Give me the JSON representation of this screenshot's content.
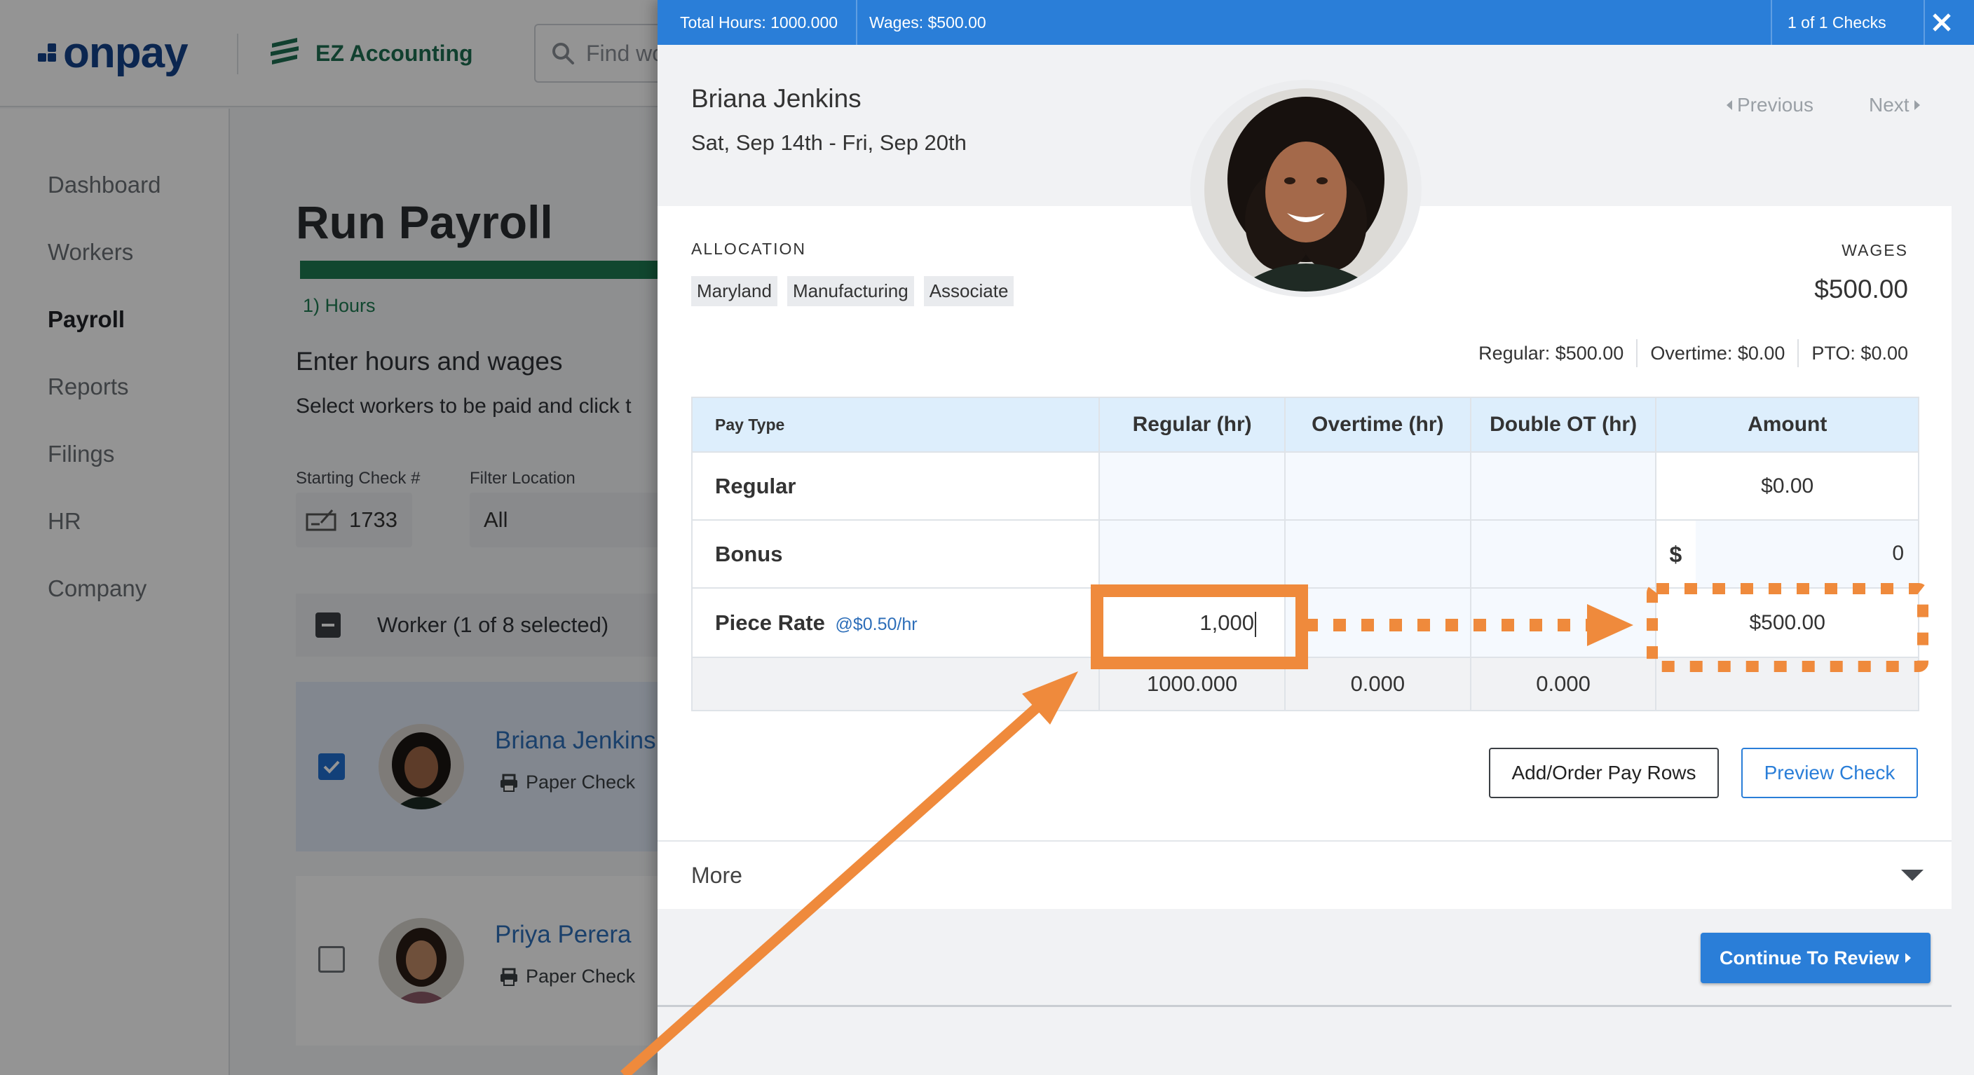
{
  "app": {
    "brand": "onpay",
    "client_name": "EZ Accounting",
    "search_placeholder": "Find wo"
  },
  "sidebar": {
    "items": [
      {
        "label": "Dashboard"
      },
      {
        "label": "Workers"
      },
      {
        "label": "Payroll",
        "active": true
      },
      {
        "label": "Reports"
      },
      {
        "label": "Filings"
      },
      {
        "label": "HR"
      },
      {
        "label": "Company"
      }
    ]
  },
  "main": {
    "title": "Run Payroll",
    "step_label": "1) Hours",
    "section_title": "Enter hours and wages",
    "section_subtitle": "Select workers to be paid and click t",
    "starting_check_label": "Starting Check #",
    "starting_check_value": "1733",
    "filter_location_label": "Filter Location",
    "filter_location_value": "All",
    "worker_header": "Worker (1 of 8 selected)",
    "workers": [
      {
        "name": "Briana Jenkins",
        "method": "Paper Check",
        "selected": true
      },
      {
        "name": "Priya Perera",
        "method": "Paper Check",
        "selected": false
      }
    ]
  },
  "panel": {
    "topbar": {
      "total_hours": "Total Hours: 1000.000",
      "wages": "Wages: $500.00",
      "check_count": "1 of 1 Checks"
    },
    "employee_name": "Briana Jenkins",
    "pay_period": "Sat, Sep 14th - Fri, Sep 20th",
    "previous_label": "Previous",
    "next_label": "Next",
    "allocation_label": "ALLOCATION",
    "allocation_tags": [
      "Maryland",
      "Manufacturing",
      "Associate"
    ],
    "wages_label": "WAGES",
    "wages_value": "$500.00",
    "breakdown": {
      "regular": "Regular: $500.00",
      "overtime": "Overtime: $0.00",
      "pto": "PTO: $0.00"
    },
    "table": {
      "headers": [
        "Pay Type",
        "Regular (hr)",
        "Overtime (hr)",
        "Double OT (hr)",
        "Amount"
      ],
      "regular": {
        "label": "Regular",
        "amount": "$0.00"
      },
      "bonus": {
        "label": "Bonus",
        "currency": "$",
        "amount": "0"
      },
      "piece_rate": {
        "label": "Piece Rate",
        "rate": "@$0.50/hr",
        "regular_hours": "1,000",
        "amount": "$500.00"
      },
      "totals": {
        "regular": "1000.000",
        "overtime": "0.000",
        "double_ot": "0.000"
      }
    },
    "add_rows_label": "Add/Order Pay Rows",
    "preview_label": "Preview Check",
    "more_label": "More",
    "continue_label": "Continue To Review"
  },
  "colors": {
    "accent_blue": "#2a7ed8",
    "brand_navy": "#14428b",
    "progress_green": "#1e7b52",
    "annotation_orange": "#ef8a3c"
  }
}
